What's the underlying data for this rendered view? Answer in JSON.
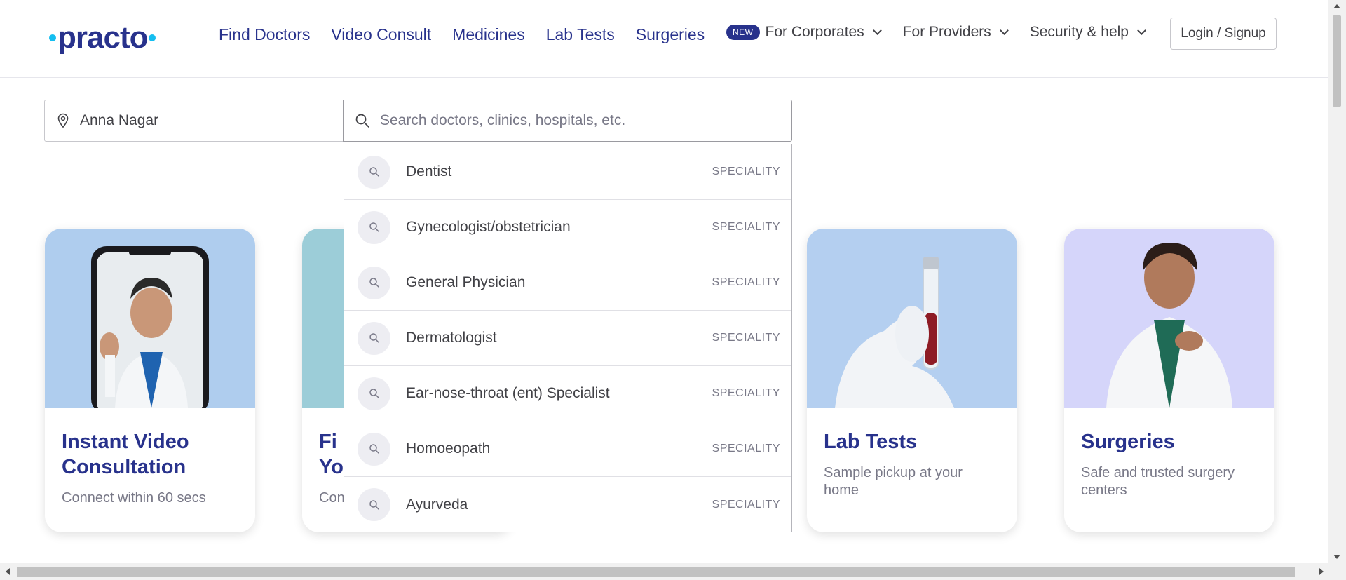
{
  "brand": {
    "logo_text": "practo",
    "accent": "#14bef0",
    "primary": "#28328c"
  },
  "nav": {
    "items": [
      "Find Doctors",
      "Video Consult",
      "Medicines",
      "Lab Tests",
      "Surgeries"
    ],
    "new_badge": "NEW",
    "dropdowns": [
      "For Corporates",
      "For Providers",
      "Security & help"
    ],
    "login": "Login / Signup"
  },
  "search": {
    "location_value": "Anna Nagar",
    "location_icon": "map-pin-icon",
    "query_placeholder": "Search doctors, clinics, hospitals, etc.",
    "query_value": "",
    "search_icon": "search-icon"
  },
  "suggestions": [
    {
      "label": "Dentist",
      "type": "SPECIALITY"
    },
    {
      "label": "Gynecologist/obstetrician",
      "type": "SPECIALITY"
    },
    {
      "label": "General Physician",
      "type": "SPECIALITY"
    },
    {
      "label": "Dermatologist",
      "type": "SPECIALITY"
    },
    {
      "label": "Ear-nose-throat (ent) Specialist",
      "type": "SPECIALITY"
    },
    {
      "label": "Homoeopath",
      "type": "SPECIALITY"
    },
    {
      "label": "Ayurveda",
      "type": "SPECIALITY"
    }
  ],
  "cards": [
    {
      "title_line1": "Instant Video",
      "title_line2": "Consultation",
      "subtitle_line1": "Connect within 60 secs",
      "subtitle_line2": "",
      "bg": "#afcdee"
    },
    {
      "title_line1": "Fi",
      "title_line2": "Yo",
      "subtitle_line1": "Con",
      "subtitle_line2": "",
      "bg": "#9ccdd8"
    },
    {
      "title_line1": "Lab Tests",
      "title_line2": "",
      "subtitle_line1": "Sample pickup at your",
      "subtitle_line2": "home",
      "bg": "#b4cff0"
    },
    {
      "title_line1": "Surgeries",
      "title_line2": "",
      "subtitle_line1": "Safe and trusted surgery",
      "subtitle_line2": "centers",
      "bg": "#d5d5fa"
    }
  ]
}
